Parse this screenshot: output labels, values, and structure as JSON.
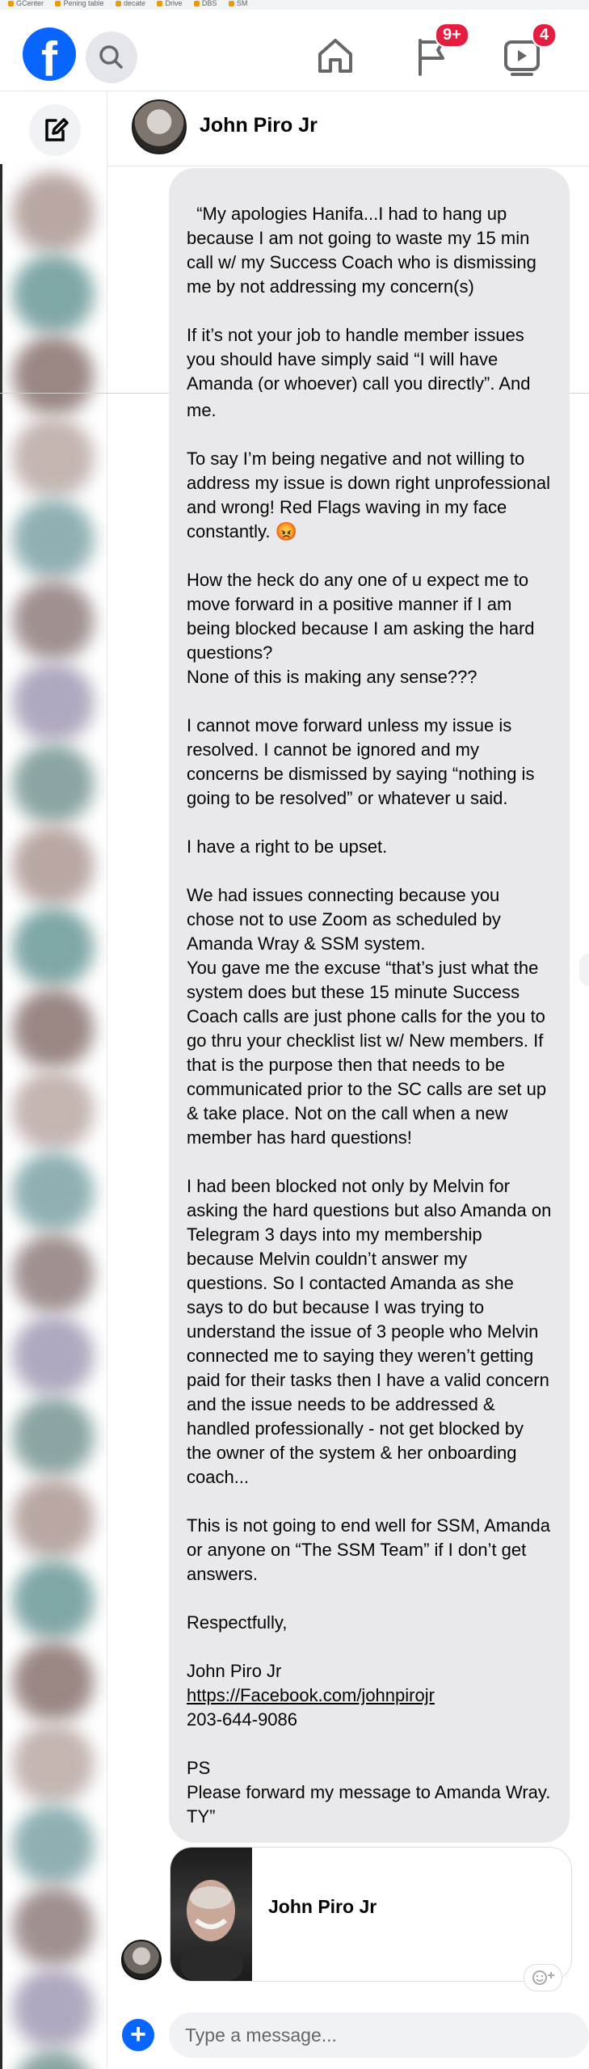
{
  "bookmarks": [
    "GCenter",
    "Pening table",
    "decate",
    "Drive",
    "DBS",
    "SM"
  ],
  "brand": {
    "logo_letter": "f",
    "accent": "#0866ff"
  },
  "nav": {
    "home_icon": "home-icon",
    "pages_icon": "flag-icon",
    "pages_badge": "9+",
    "watch_icon": "video-icon",
    "watch_badge": "4"
  },
  "conversation": {
    "contact_name": "John Piro Jr"
  },
  "messages": {
    "part1": "“My apologies Hanifa...I had to hang up because I am not going to waste my 15 min call w/ my Success Coach who is dismissing me by not addressing my concern(s)\n\nIf it’s not your job to handle member issues you should have simply said “I will have Amanda (or whoever) call you directly”. And then be sure she follows through.",
    "part2": "me.\n\nTo say I’m being negative and not willing to address my issue is down right unprofessional and wrong! Red Flags waving in my face constantly. 😡\n\nHow the heck do any one of u expect me to move forward in a positive manner if I am being blocked because I am asking the hard questions?\nNone of this is making any sense???\n\nI cannot move forward unless my issue is resolved. I cannot be ignored and my concerns be dismissed by saying “nothing is going to be resolved” or whatever u said.\n\nI have a right to be upset.\n\nWe had issues connecting because you chose not to use Zoom as scheduled by Amanda Wray & SSM system.\nYou gave me the excuse “that’s just what the system does but these 15 minute Success Coach calls are just phone calls for the you to go thru your checklist list w/ New members. If that is the purpose then that needs to be communicated prior to the SC calls are set up & take place. Not on the call when a new member has hard questions!\n\nI had been blocked not only by Melvin for asking the hard questions but also Amanda on Telegram 3 days into my membership because Melvin couldn’t answer my questions. So I contacted Amanda as she says to do but because I was trying to understand the issue of 3 people who Melvin connected me to saying they weren’t getting paid for their tasks then I have a valid concern and the issue needs to be addressed & handled professionally - not get blocked by the owner of the system & her onboarding coach...\n\nThis is not going to end well for SSM, Amanda or anyone on “The SSM Team” if I don’t get answers.\n\nRespectfully,\n\nJohn Piro Jr",
    "link": "https://Facebook.com/johnpirojr",
    "part3": "203-644-9086\n\nPS\nPlease forward my message to Amanda Wray. TY”"
  },
  "profile_card": {
    "name": "John Piro Jr"
  },
  "composer": {
    "placeholder": "Type a message..."
  }
}
